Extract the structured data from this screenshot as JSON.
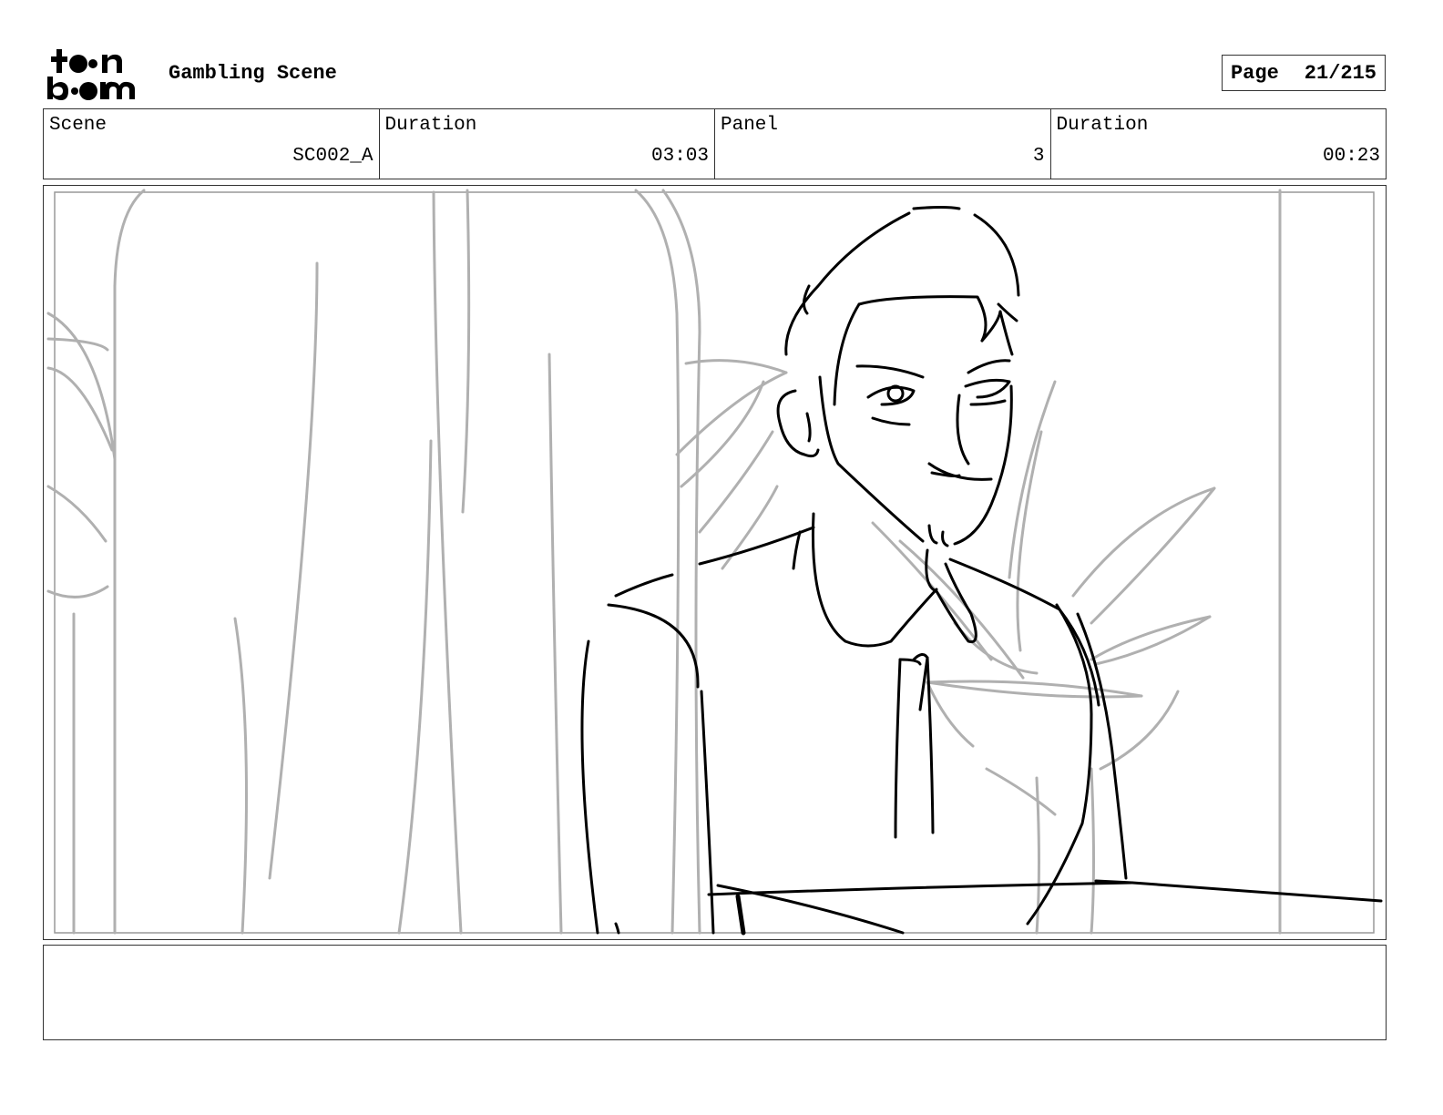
{
  "header": {
    "logo_text": "toonboom",
    "title": "Gambling Scene",
    "page_label": "Page",
    "page_value": "21/215"
  },
  "info": [
    {
      "label": "Scene",
      "value": "SC002_A"
    },
    {
      "label": "Duration",
      "value": "03:03"
    },
    {
      "label": "Panel",
      "value": "3"
    },
    {
      "label": "Duration",
      "value": "00:23"
    }
  ],
  "notes": {
    "text": ""
  }
}
